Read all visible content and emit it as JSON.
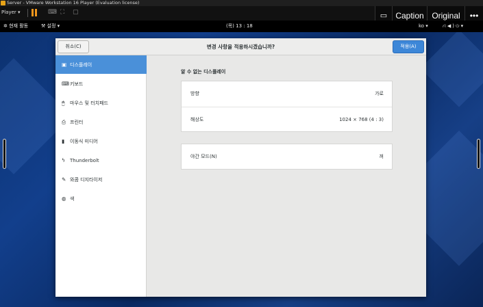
{
  "vmware": {
    "title": "Server - VMware Workstation 16 Player (Evaluation license)",
    "player_label": "Player ▾",
    "overlay": {
      "caption": "Caption",
      "original": "Original",
      "more": "•••"
    }
  },
  "gnome_bar": {
    "activities": "현재 활동",
    "settings_menu": "설정 ▾",
    "clock": "(목) 13 : 18",
    "input_lang": "ko ▾"
  },
  "dialog": {
    "cancel_label": "취소(C)",
    "title": "변경 사항을 적용하시겠습니까?",
    "apply_label": "적용(A)"
  },
  "sidebar": {
    "items": [
      {
        "label": "디스플레이",
        "icon": "display-icon",
        "glyph": "▣",
        "selected": true
      },
      {
        "label": "키보드",
        "icon": "keyboard-icon",
        "glyph": "⌨",
        "selected": false
      },
      {
        "label": "마우스 및 터치패드",
        "icon": "mouse-icon",
        "glyph": "🖱",
        "selected": false
      },
      {
        "label": "프린터",
        "icon": "printer-icon",
        "glyph": "⎙",
        "selected": false
      },
      {
        "label": "이동식 미디어",
        "icon": "removable-media-icon",
        "glyph": "▮",
        "selected": false
      },
      {
        "label": "Thunderbolt",
        "icon": "thunderbolt-icon",
        "glyph": "ϟ",
        "selected": false
      },
      {
        "label": "와콤 디지타이저",
        "icon": "wacom-tablet-icon",
        "glyph": "✎",
        "selected": false
      },
      {
        "label": "색",
        "icon": "color-icon",
        "glyph": "◍",
        "selected": false
      }
    ]
  },
  "display": {
    "heading": "알 수 없는 디스플레이",
    "orientation_label": "방향",
    "orientation_value": "가로",
    "resolution_label": "해상도",
    "resolution_value": "1024 × 768 (4 : 3)",
    "night_mode_label": "야간 모드(N)",
    "night_mode_value": "꺼"
  }
}
